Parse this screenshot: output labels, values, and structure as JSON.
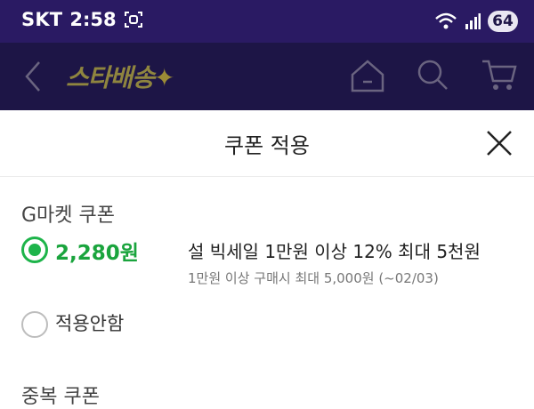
{
  "status_bar": {
    "carrier": "SKT",
    "time": "2:58",
    "battery": "64"
  },
  "app_header": {
    "brand": "스타배송",
    "brand_star": "✦"
  },
  "sheet": {
    "title": "쿠폰 적용",
    "section_gmarket": "G마켓 쿠폰",
    "coupon": {
      "amount": "2,280원",
      "name": "설 빅세일 1만원 이상 12% 최대 5천원",
      "condition": "1만원 이상 구매시 최대 5,000원 (~02/03)",
      "selected": true
    },
    "no_apply_label": "적용안함",
    "section_duplicate": "중복 쿠폰"
  },
  "colors": {
    "status_bar": "#2a1a63",
    "header_dim": "#1d1546",
    "accent_green": "#1db44a"
  },
  "icons": [
    "back-arrow-icon",
    "home-icon",
    "search-icon",
    "cart-icon",
    "close-icon",
    "wifi-icon",
    "signal-icon",
    "screenshot-icon"
  ]
}
